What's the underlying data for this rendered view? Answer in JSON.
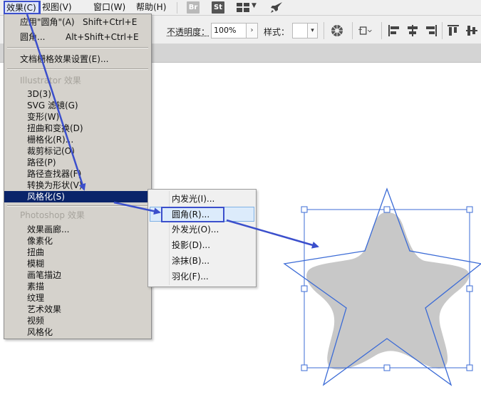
{
  "menubar": {
    "effects": "效果(C)",
    "view": "视图(V)",
    "window": "窗口(W)",
    "help": "帮助(H)",
    "bridge_badge": "Br",
    "stock_badge": "St",
    "workspace_icon": "workspace-grid-icon",
    "rocket_icon": "rocket-icon"
  },
  "controlbar": {
    "opacity_label": "不透明度：",
    "opacity_value": "100%",
    "style_label": "样式："
  },
  "effects_menu": {
    "apply_last": "应用\"圆角\"(A)",
    "apply_last_shortcut": "Shift+Ctrl+E",
    "last_effect": "圆角...",
    "last_effect_shortcut": "Alt+Shift+Ctrl+E",
    "document_raster": "文档栅格效果设置(E)...",
    "illustrator_header": "Illustrator 效果",
    "illustrator_items": [
      "3D(3)",
      "SVG 滤镜(G)",
      "变形(W)",
      "扭曲和变换(D)",
      "栅格化(R)...",
      "裁剪标记(O)",
      "路径(P)",
      "路径查找器(F)",
      "转换为形状(V)",
      "风格化(S)"
    ],
    "photoshop_header": "Photoshop 效果",
    "photoshop_items": [
      "效果画廊...",
      "像素化",
      "扭曲",
      "模糊",
      "画笔描边",
      "素描",
      "纹理",
      "艺术效果",
      "视频",
      "风格化"
    ]
  },
  "stylize_submenu": {
    "items": [
      "内发光(I)...",
      "圆角(R)...",
      "外发光(O)...",
      "投影(D)...",
      "涂抹(B)...",
      "羽化(F)..."
    ]
  },
  "colors": {
    "annotation": "#3b4fcc",
    "highlight": "#0a246a",
    "star_fill": "#c8c8c8",
    "selection": "#3b6bd6"
  }
}
